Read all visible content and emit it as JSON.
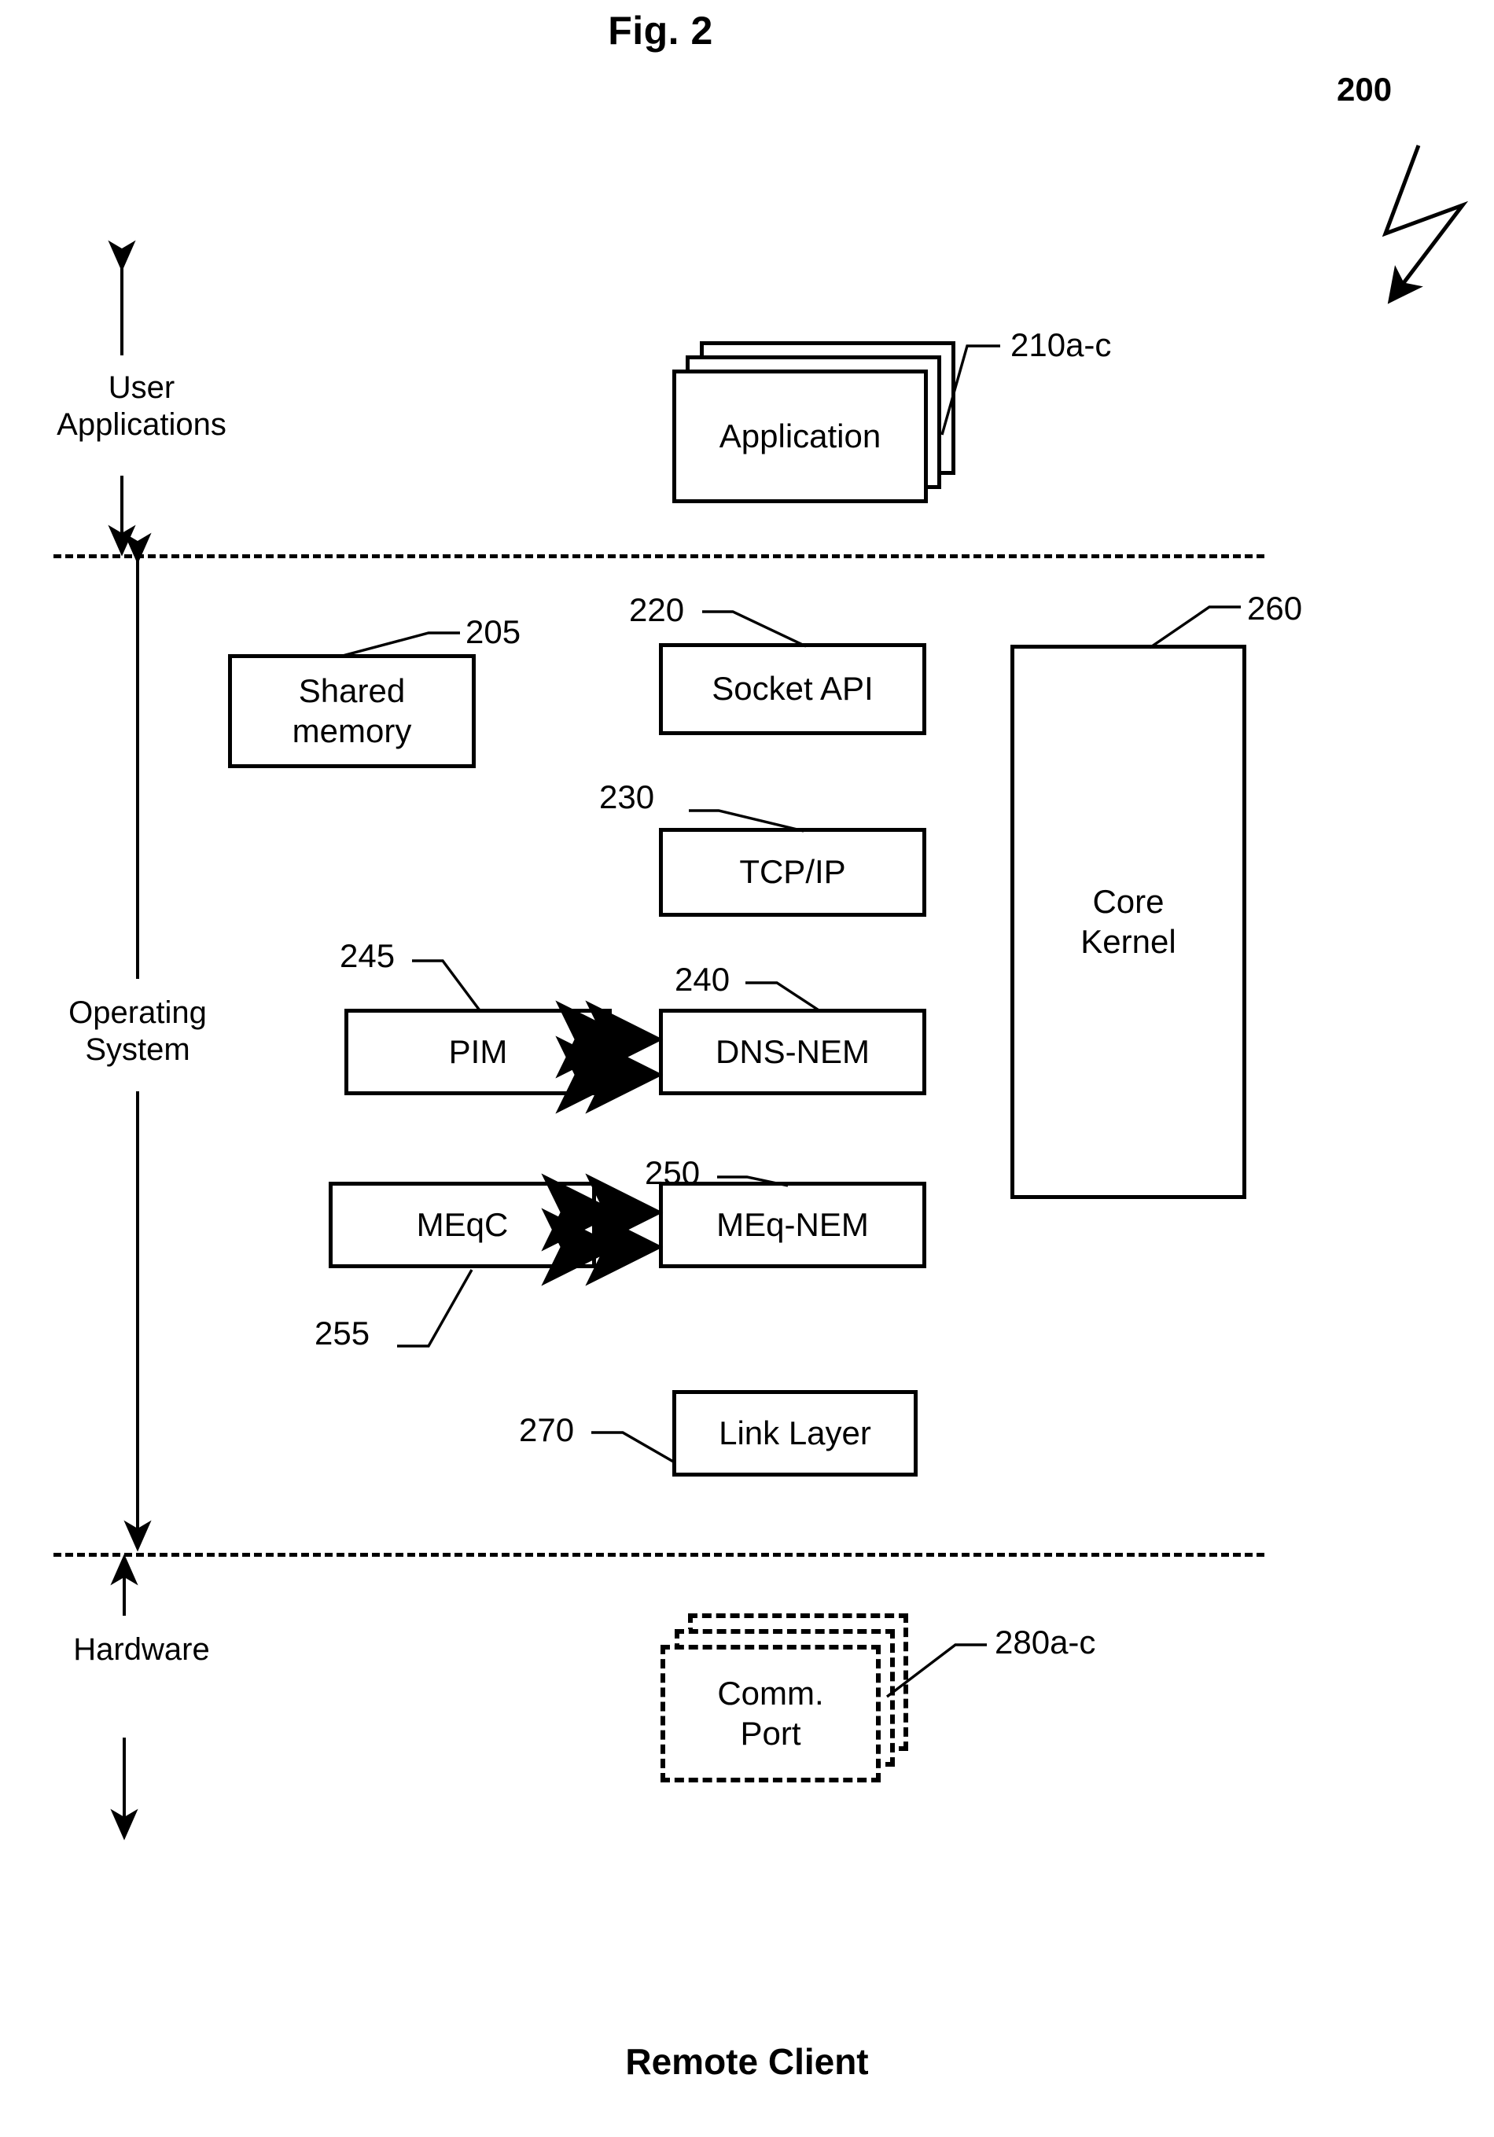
{
  "figure": {
    "title": "Fig. 2",
    "reference_numeral": "200",
    "caption": "Remote Client"
  },
  "layers": [
    {
      "id": "user-applications",
      "label": "User\nApplications"
    },
    {
      "id": "operating-system",
      "label": "Operating\nSystem"
    },
    {
      "id": "hardware",
      "label": "Hardware"
    }
  ],
  "blocks": [
    {
      "id": "application",
      "label": "Application",
      "ref": "210a-c",
      "style": "stacked-solid"
    },
    {
      "id": "shared-memory",
      "label": "Shared\nmemory",
      "ref": "205",
      "style": "solid"
    },
    {
      "id": "socket-api",
      "label": "Socket  API",
      "ref": "220",
      "style": "solid"
    },
    {
      "id": "tcp-ip",
      "label": "TCP/IP",
      "ref": "230",
      "style": "solid"
    },
    {
      "id": "pim",
      "label": "PIM",
      "ref": "245",
      "style": "solid"
    },
    {
      "id": "dns-nem",
      "label": "DNS-NEM",
      "ref": "240",
      "style": "solid"
    },
    {
      "id": "meqc",
      "label": "MEqC",
      "ref": "255",
      "style": "solid"
    },
    {
      "id": "meq-nem",
      "label": "MEq-NEM",
      "ref": "250",
      "style": "solid"
    },
    {
      "id": "link-layer",
      "label": "Link Layer",
      "ref": "270",
      "style": "solid"
    },
    {
      "id": "core-kernel",
      "label": "Core\nKernel",
      "ref": "260",
      "style": "solid"
    },
    {
      "id": "comm-port",
      "label": "Comm.\nPort",
      "ref": "280a-c",
      "style": "stacked-dashed"
    }
  ],
  "connectors": [
    {
      "from": "pim",
      "to": "dns-nem",
      "type": "double-headed",
      "count": 2
    },
    {
      "from": "meqc",
      "to": "meq-nem",
      "type": "double-headed",
      "count": 2
    }
  ],
  "colors": {
    "stroke": "#000000",
    "background": "#ffffff"
  }
}
